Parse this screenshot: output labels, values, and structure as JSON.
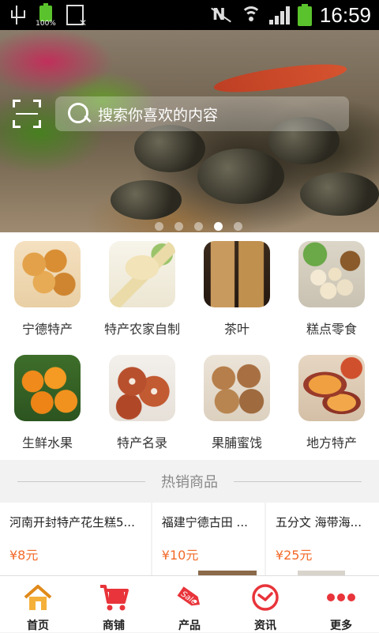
{
  "status_bar": {
    "battery_small_label": "100%",
    "time": "16:59"
  },
  "search": {
    "placeholder": "搜索你喜欢的内容"
  },
  "banner": {
    "slide_count": 5,
    "active_slide": 4
  },
  "categories": [
    {
      "label": "宁德特产",
      "icon": "pastry-image"
    },
    {
      "label": "特产农家自制",
      "icon": "dried-root-image"
    },
    {
      "label": "茶叶",
      "icon": "tea-bags-image"
    },
    {
      "label": "糕点零食",
      "icon": "snack-balls-image"
    },
    {
      "label": "生鲜水果",
      "icon": "oranges-image"
    },
    {
      "label": "特产名录",
      "icon": "lotus-root-image"
    },
    {
      "label": "果脯蜜饯",
      "icon": "preserved-fruit-image"
    },
    {
      "label": "地方特产",
      "icon": "sweet-potato-image"
    }
  ],
  "hot": {
    "title": "热销商品"
  },
  "products": [
    {
      "name": "河南开封特产花生糕5...",
      "price": "¥8元"
    },
    {
      "name": "福建宁德古田 ...",
      "price": "¥10元"
    },
    {
      "name": "五分文 海带海...",
      "price": "¥25元"
    }
  ],
  "tabs": [
    {
      "label": "首页",
      "icon": "home-icon"
    },
    {
      "label": "商铺",
      "icon": "cart-icon"
    },
    {
      "label": "产品",
      "icon": "sale-tag-icon"
    },
    {
      "label": "资讯",
      "icon": "clock-icon"
    },
    {
      "label": "更多",
      "icon": "more-dots-icon"
    }
  ],
  "colors": {
    "accent": "#e8343a",
    "price": "#f26a2a",
    "home_icon": "#f0a030"
  }
}
